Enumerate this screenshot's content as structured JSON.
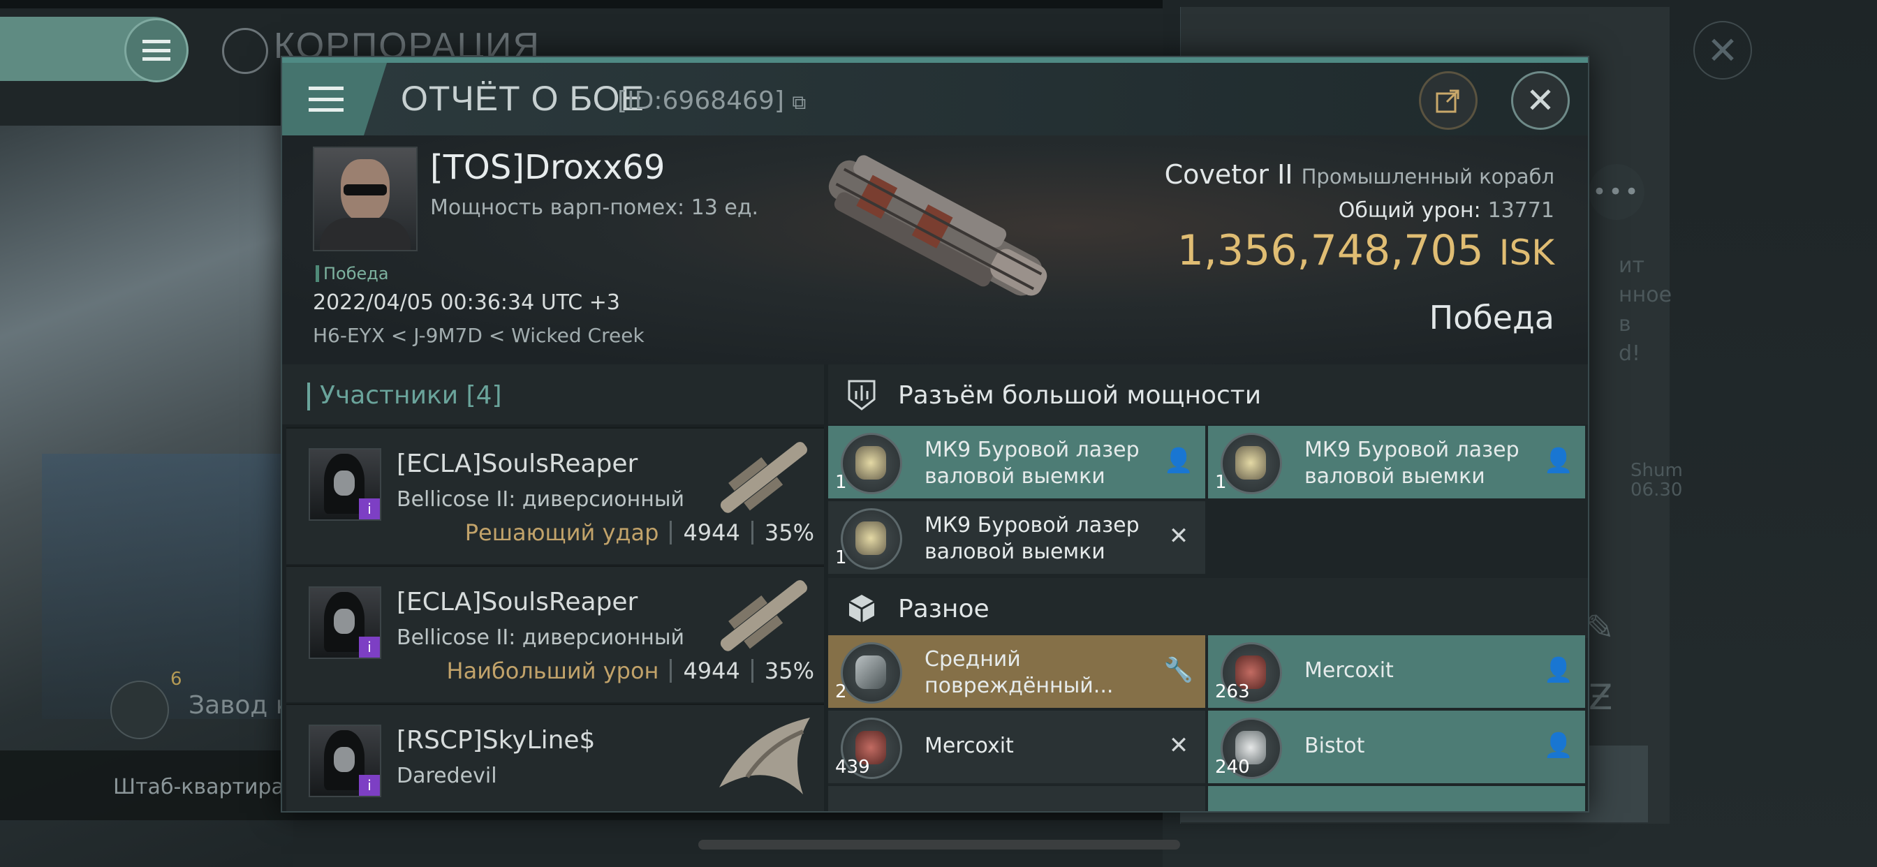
{
  "background": {
    "corp_title": "КОРПОРАЦИЯ",
    "factory_count": "6",
    "factory_label": "Завод к",
    "footer_label": "Штаб-квартира К",
    "right_text": "ит\nнное\nв\nd!",
    "right_shum": "Shum\n06.30"
  },
  "header": {
    "title": "ОТЧЁТ О БОЕ",
    "report_id": "[ID:6968469]"
  },
  "victim": {
    "name": "[TOS]Droxx69",
    "warp_strength": "Мощность варп-помех: 13 ед.",
    "status": "Победа",
    "datetime": "2022/04/05 00:36:34 UTC +3",
    "location": "H6-EYX < J-9M7D < Wicked Creek",
    "ship_name": "Covetor II",
    "ship_class": "Промышленный корабл",
    "total_damage_label": "Общий урон:",
    "total_damage_value": "13771",
    "isk_value": "1,356,748,705",
    "isk_unit": "ISK",
    "result": "Победа"
  },
  "participants": {
    "header": "Участники [4]",
    "list": [
      {
        "name": "[ECLA]SoulsReaper",
        "ship": "Bellicose II: диверсионный",
        "label": "Решающий удар",
        "damage": "4944",
        "percent": "35%"
      },
      {
        "name": "[ECLA]SoulsReaper",
        "ship": "Bellicose II: диверсионный",
        "label": "Наибольший урон",
        "damage": "4944",
        "percent": "35%"
      },
      {
        "name": "[RSCP]SkyLine$",
        "ship": "Daredevil",
        "label": "",
        "damage": "",
        "percent": ""
      }
    ]
  },
  "high_slots": {
    "header": "Разъём большой мощности",
    "items": [
      {
        "name": "МК9 Буровой лазер валовой выемки",
        "qty": "1",
        "state": "dropped"
      },
      {
        "name": "МК9 Буровой лазер валовой выемки",
        "qty": "1",
        "state": "dropped"
      },
      {
        "name": "МК9 Буровой лазер валовой выемки",
        "qty": "1",
        "state": "destroyed"
      }
    ]
  },
  "misc": {
    "header": "Разное",
    "items": [
      {
        "name": "Средний повреждённый...",
        "qty": "2",
        "state": "damaged"
      },
      {
        "name": "Mercoxit",
        "qty": "263",
        "state": "dropped"
      },
      {
        "name": "Mercoxit",
        "qty": "439",
        "state": "destroyed"
      },
      {
        "name": "Bistot",
        "qty": "240",
        "state": "dropped"
      }
    ]
  },
  "colors": {
    "accent_teal": "#4d7c75",
    "isk_gold": "#e0bd73",
    "damaged_gold": "#857048",
    "label_gold": "#c2a36a"
  }
}
